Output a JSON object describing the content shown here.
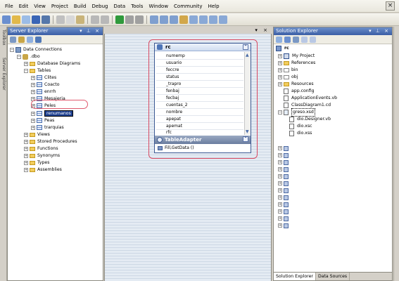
{
  "menu": {
    "items": [
      "File",
      "Edit",
      "View",
      "Project",
      "Build",
      "Debug",
      "Data",
      "Tools",
      "Window",
      "Community",
      "Help"
    ]
  },
  "left_strip": {
    "tabs": [
      "Toolbox",
      "Server Explorer"
    ]
  },
  "server_explorer": {
    "title": "Server Explorer",
    "tree": {
      "connections": "Data Connections",
      "db": ".dbo",
      "items": [
        "Database Diagrams",
        "Tables",
        "Views",
        "Stored Procedures",
        "Functions",
        "Synonyms",
        "Types",
        "Assemblies"
      ],
      "tables": [
        "Clites",
        "Coacto",
        "enrrh",
        "Mesajeria",
        "Peles",
        "renumanos",
        "Peas",
        "trarquias"
      ]
    }
  },
  "designer": {
    "table_title": "rc",
    "columns": [
      "numemp",
      "usuario",
      "feccre",
      "status",
      "_trapro",
      "fenbaj",
      "fecbaj",
      "cuentas_2",
      "nombre",
      "apepat",
      "apemat",
      "rfc"
    ],
    "adapter_title": "TableAdapter",
    "adapter_method": "Fill,GetData ()"
  },
  "solution_explorer": {
    "title": "Solution Explorer",
    "project": "rc",
    "items": [
      "My Project",
      "References",
      "bin",
      "obj",
      "Resources",
      "app.config",
      "ApplicationEvents.vb",
      "ClassDiagram1.cd"
    ],
    "dataset": "greso.xsd",
    "dataset_children": [
      "dio.Designer.vb",
      "dio.xsc",
      "dio.xss"
    ],
    "tabs": [
      "Solution Explorer",
      "Data Sources"
    ]
  }
}
